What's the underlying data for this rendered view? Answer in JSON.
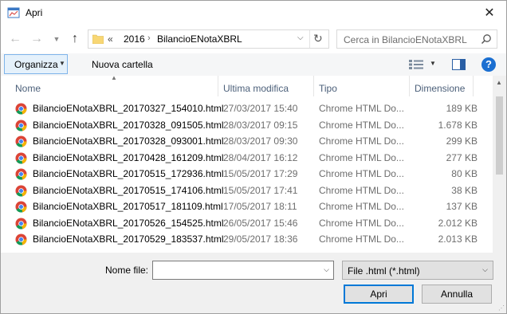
{
  "window": {
    "title": "Apri"
  },
  "nav": {
    "breadcrumb_more": "«",
    "breadcrumb": [
      "2016",
      "BilancioENotaXBRL"
    ],
    "search_placeholder": "Cerca in BilancioENotaXBRL"
  },
  "toolbar": {
    "organize_label": "Organizza",
    "new_folder_label": "Nuova cartella"
  },
  "columns": {
    "name": "Nome",
    "date": "Ultima modifica",
    "type": "Tipo",
    "size": "Dimensione"
  },
  "files": [
    {
      "name": "BilancioENotaXBRL_20170327_154010.html",
      "date": "27/03/2017 15:40",
      "type": "Chrome HTML Do...",
      "size": "189 KB"
    },
    {
      "name": "BilancioENotaXBRL_20170328_091505.html",
      "date": "28/03/2017 09:15",
      "type": "Chrome HTML Do...",
      "size": "1.678 KB"
    },
    {
      "name": "BilancioENotaXBRL_20170328_093001.html",
      "date": "28/03/2017 09:30",
      "type": "Chrome HTML Do...",
      "size": "299 KB"
    },
    {
      "name": "BilancioENotaXBRL_20170428_161209.html",
      "date": "28/04/2017 16:12",
      "type": "Chrome HTML Do...",
      "size": "277 KB"
    },
    {
      "name": "BilancioENotaXBRL_20170515_172936.html",
      "date": "15/05/2017 17:29",
      "type": "Chrome HTML Do...",
      "size": "80 KB"
    },
    {
      "name": "BilancioENotaXBRL_20170515_174106.html",
      "date": "15/05/2017 17:41",
      "type": "Chrome HTML Do...",
      "size": "38 KB"
    },
    {
      "name": "BilancioENotaXBRL_20170517_181109.html",
      "date": "17/05/2017 18:11",
      "type": "Chrome HTML Do...",
      "size": "137 KB"
    },
    {
      "name": "BilancioENotaXBRL_20170526_154525.html",
      "date": "26/05/2017 15:46",
      "type": "Chrome HTML Do...",
      "size": "2.012 KB"
    },
    {
      "name": "BilancioENotaXBRL_20170529_183537.html",
      "date": "29/05/2017 18:36",
      "type": "Chrome HTML Do...",
      "size": "2.013 KB"
    }
  ],
  "file_icon": "chrome-icon",
  "bottom": {
    "filename_label": "Nome file:",
    "filename_value": "",
    "filter_value": "File .html (*.html)",
    "open_label": "Apri",
    "cancel_label": "Annulla"
  },
  "colors": {
    "accent": "#0078d7",
    "header_text": "#4c607a"
  }
}
